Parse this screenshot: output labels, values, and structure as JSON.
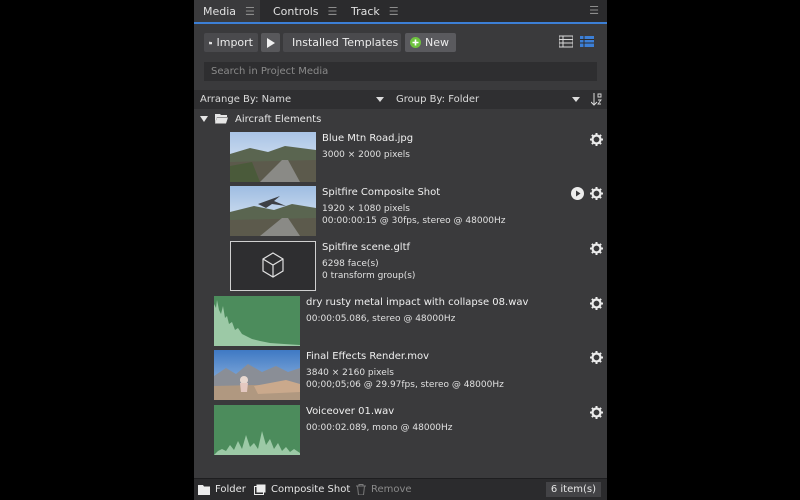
{
  "tabs": [
    {
      "label": "Media"
    },
    {
      "label": "Controls"
    },
    {
      "label": "Track"
    }
  ],
  "toolbar": {
    "import_label": "Import",
    "templates_label": "Installed Templates",
    "new_label": "New"
  },
  "search": {
    "placeholder": "Search in Project Media"
  },
  "arrange": {
    "arrange_by": "Arrange By: Name",
    "group_by": "Group By: Folder"
  },
  "folder": {
    "name": "Aircraft Elements"
  },
  "items": [
    {
      "name": "Blue Mtn Road.jpg",
      "meta1": "3000 × 2000 pixels",
      "meta2": ""
    },
    {
      "name": "Spitfire Composite Shot",
      "meta1": "1920 × 1080 pixels",
      "meta2": "00:00:00:15 @ 30fps, stereo @ 48000Hz"
    },
    {
      "name": "Spitfire scene.gltf",
      "meta1": "6298 face(s)",
      "meta2": "0 transform group(s)"
    },
    {
      "name": "dry rusty metal impact with collapse 08.wav",
      "meta1": "00:00:05.086, stereo @ 48000Hz",
      "meta2": ""
    },
    {
      "name": "Final Effects Render.mov",
      "meta1": "3840 × 2160 pixels",
      "meta2": "00;00;05;06 @ 29.97fps, stereo @ 48000Hz"
    },
    {
      "name": "Voiceover 01.wav",
      "meta1": "00:00:02.089, mono @ 48000Hz",
      "meta2": ""
    }
  ],
  "footer": {
    "folder_label": "Folder",
    "composite_label": "Composite Shot",
    "remove_label": "Remove",
    "count": "6 item(s)"
  },
  "colors": {
    "accent": "#3c7fd6",
    "new_icon": "#6ec23f",
    "audio_wave": "#4c8c5c"
  }
}
